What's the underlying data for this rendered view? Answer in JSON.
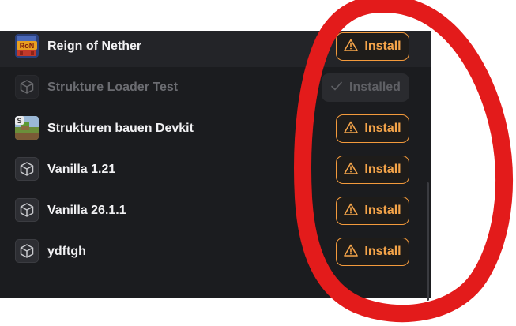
{
  "modpacks": [
    {
      "name": "Reign of Nether",
      "icon": "reign-of-nether-logo",
      "logo_text": "RoN",
      "action": "Install",
      "state": "available"
    },
    {
      "name": "Strukture Loader Test",
      "icon": "cube-icon",
      "action": "Installed",
      "state": "installed"
    },
    {
      "name": "Strukturen bauen Devkit",
      "icon": "minecraft-grass-block-thumbnail",
      "action": "Install",
      "state": "available"
    },
    {
      "name": "Vanilla 1.21",
      "icon": "cube-icon",
      "action": "Install",
      "state": "available"
    },
    {
      "name": "Vanilla 26.1.1",
      "icon": "cube-icon",
      "action": "Install",
      "state": "available"
    },
    {
      "name": "ydftgh",
      "icon": "cube-icon",
      "action": "Install",
      "state": "available"
    }
  ],
  "colors": {
    "panel_bg": "#1b1c1f",
    "install_accent": "#f39a3c",
    "installed_text": "#5f6065",
    "annotation_circle": "#e31b1b"
  }
}
